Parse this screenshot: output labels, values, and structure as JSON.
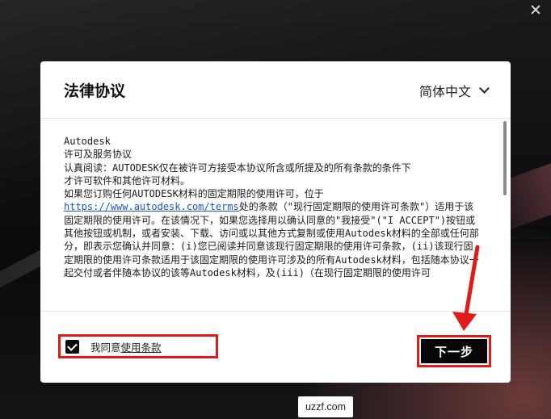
{
  "dialog": {
    "title": "法律协议",
    "language": "简体中文",
    "agreement_lines": [
      "Autodesk",
      "许可及服务协议",
      "认真阅读：AUTODESK仅在被许可方接受本协议所含或所提及的所有条款的条件下",
      "才许可软件和其他许可材料。",
      "如果您订购任何AUTODESK材料的固定期限的使用许可，位于"
    ],
    "terms_url": "https://www.autodesk.com/terms",
    "agreement_after_url": "处的条款（\"现行固定期限的使用许可条款\"）适用于该固定期限的使用许可。在该情况下，如果您选择用以确认同意的\"我接受\"(\"I ACCEPT\")按钮或其他按钮或机制，或者安装、下载、访问或以其他方式复制或使用Autodesk材料的全部或任何部分，即表示您确认并同意：(i)您已阅读并同意该现行固定期限的使用许可条款，(ii)该现行固定期限的使用许可条款适用于该固定期限的使用许可涉及的所有Autodesk材料，包括随本协议一起交付或者伴随本协议的该等Autodesk材料，及(iii)（在现行固定期限的使用许可"
  },
  "footer": {
    "agree_prefix": "我同意",
    "agree_link": "使用条款",
    "agree_checked": true,
    "next_label": "下一步"
  },
  "watermark": "uzzf.com",
  "colors": {
    "annotation_red": "#e01919",
    "button_bg": "#070707",
    "link_blue": "#1b56c7"
  }
}
